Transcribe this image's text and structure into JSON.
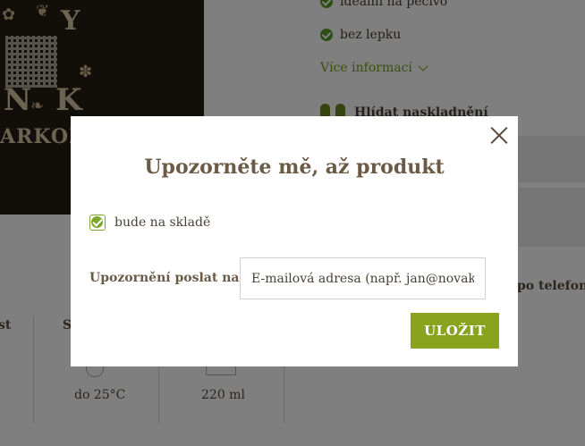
{
  "background": {
    "product_image": {
      "label_y": "Y",
      "label_n": "N",
      "label_k": "K",
      "label_brand": "ARKOLA"
    },
    "features": [
      {
        "text": "ideální na pečivo"
      },
      {
        "text": "bez lepku"
      }
    ],
    "more_info": "Více informací",
    "watch_stock": "Hlídat naskladnění",
    "phone_text": "po telefonu?",
    "spec_fragments": [
      "st",
      "S"
    ],
    "spec_values": [
      "do 25°C",
      "220 ml"
    ]
  },
  "modal": {
    "title": "Upozorněte mě, až produkt",
    "stock_option": "bude na skladě",
    "stock_checked": true,
    "email_label": "Upozornění poslat na",
    "required_mark": "*",
    "email_placeholder": "E-mailová adresa (např. jan@novak.cz)",
    "email_value": "",
    "save_label": "ULOŽIT"
  },
  "colors": {
    "accent": "#8aa31e",
    "check_green": "#5b9a2b",
    "title_brown": "#6b5a45",
    "required_red": "#d0342c",
    "overlay": "rgba(0,0,0,0.5)"
  }
}
